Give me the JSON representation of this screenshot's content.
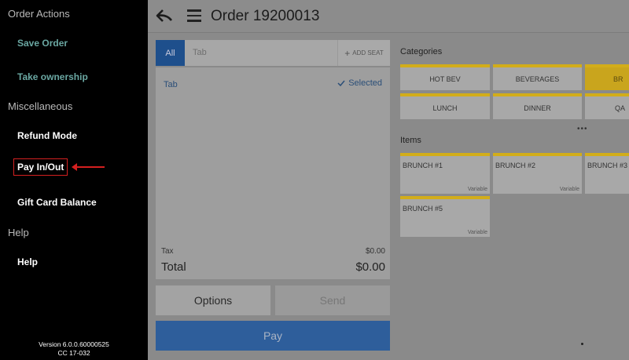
{
  "sidebar": {
    "sections": {
      "order_actions": "Order Actions",
      "miscellaneous": "Miscellaneous",
      "help": "Help"
    },
    "items": {
      "save_order": "Save Order",
      "take_ownership": "Take ownership",
      "refund_mode": "Refund Mode",
      "pay_in_out": "Pay In/Out",
      "gift_card_balance": "Gift Card Balance",
      "help": "Help"
    },
    "version_line1": "Version 6.0.0.60000525",
    "version_line2": "CC 17-032"
  },
  "header": {
    "title": "Order 19200013"
  },
  "order": {
    "tab_all": "All",
    "tab_placeholder": "Tab",
    "add_seat": "ADD SEAT",
    "row_name": "Tab",
    "row_status": "Selected",
    "tax_label": "Tax",
    "tax_value": "$0.00",
    "total_label": "Total",
    "total_value": "$0.00",
    "options_label": "Options",
    "send_label": "Send",
    "pay_label": "Pay"
  },
  "categories": {
    "label": "Categories",
    "tiles": [
      "HOT BEV",
      "BEVERAGES",
      "BR",
      "LUNCH",
      "DINNER",
      "QA"
    ]
  },
  "items": {
    "label": "Items",
    "tiles": [
      {
        "name": "BRUNCH #1",
        "tag": "Variable"
      },
      {
        "name": "BRUNCH #2",
        "tag": "Variable"
      },
      {
        "name": "BRUNCH #3",
        "tag": ""
      },
      {
        "name": "BRUNCH #5",
        "tag": "Variable"
      }
    ]
  },
  "colors": {
    "accent_blue": "#1e4f8c",
    "category_yellow": "#d2ad1a",
    "highlight_red": "#d42020"
  }
}
